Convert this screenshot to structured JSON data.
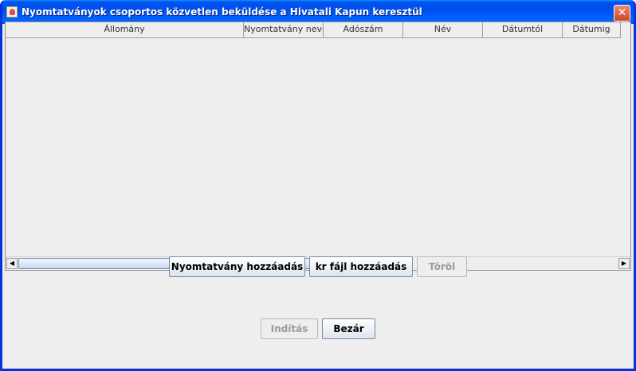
{
  "window": {
    "title": "Nyomtatványok csoportos közvetlen beküldése a Hivatali Kapun keresztül",
    "close_label": "✕"
  },
  "table": {
    "columns": [
      "Állomány",
      "Nyomtatvány neve",
      "Adószám",
      "Név",
      "Dátumtól",
      "Dátumig"
    ],
    "rows": []
  },
  "scrollbar": {
    "left_arrow": "◀",
    "right_arrow": "▶"
  },
  "actions": {
    "add_form": "Nyomtatvány hozzáadás",
    "add_kr": "kr fájl hozzáadás",
    "delete": "Töröl"
  },
  "footer": {
    "start": "Indítás",
    "close": "Bezár"
  }
}
